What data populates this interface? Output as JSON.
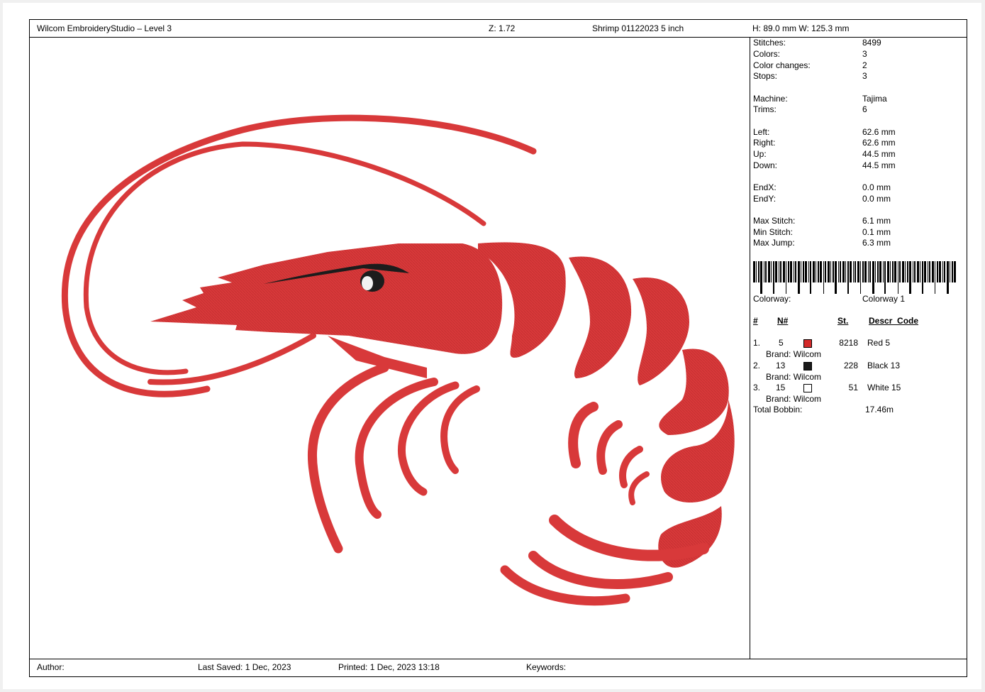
{
  "header": {
    "app": "Wilcom EmbroideryStudio – Level 3",
    "zoom": "Z: 1.72",
    "design_name": "Shrimp 01122023 5 inch",
    "size": "H: 89.0 mm  W: 125.3 mm"
  },
  "stats": [
    {
      "label": "Stitches:",
      "value": "8499"
    },
    {
      "label": "Colors:",
      "value": "3"
    },
    {
      "label": "Color changes:",
      "value": "2"
    },
    {
      "label": "Stops:",
      "value": "3"
    },
    {
      "label": "Machine:",
      "value": "Tajima"
    },
    {
      "label": "Trims:",
      "value": "6"
    },
    {
      "label": "Left:",
      "value": "62.6 mm"
    },
    {
      "label": "Right:",
      "value": "62.6 mm"
    },
    {
      "label": "Up:",
      "value": "44.5 mm"
    },
    {
      "label": "Down:",
      "value": "44.5 mm"
    },
    {
      "label": "EndX:",
      "value": "0.0 mm"
    },
    {
      "label": "EndY:",
      "value": "0.0 mm"
    },
    {
      "label": "Max Stitch:",
      "value": "6.1 mm"
    },
    {
      "label": "Min Stitch:",
      "value": "0.1 mm"
    },
    {
      "label": "Max Jump:",
      "value": "6.3 mm"
    }
  ],
  "colorway": {
    "label": "Colorway:",
    "value": "Colorway 1"
  },
  "color_table": {
    "headers": {
      "num": "#",
      "n": "N#",
      "st": "St.",
      "descr": "Descr_Code"
    },
    "rows": [
      {
        "num": "1.",
        "n": "5",
        "color": "#d42a2a",
        "st": "8218",
        "descr": "Red 5",
        "brand": "Brand: Wilcom"
      },
      {
        "num": "2.",
        "n": "13",
        "color": "#1a1a1a",
        "st": "228",
        "descr": "Black 13",
        "brand": "Brand: Wilcom"
      },
      {
        "num": "3.",
        "n": "15",
        "color": "#ffffff",
        "st": "51",
        "descr": "White 15",
        "brand": "Brand: Wilcom"
      }
    ],
    "bobbin_label": "Total Bobbin:",
    "bobbin_value": "17.46m"
  },
  "footer": {
    "author": "Author:",
    "last_saved": "Last Saved:  1 Dec, 2023",
    "printed": "Printed:  1 Dec, 2023 13:18",
    "keywords": "Keywords:"
  },
  "colors": {
    "shrimp_red": "#d8393a",
    "shrimp_dark": "#b82a2c",
    "eye": "#1c1c1c"
  },
  "icons": [
    "shrimp-design",
    "barcode"
  ]
}
